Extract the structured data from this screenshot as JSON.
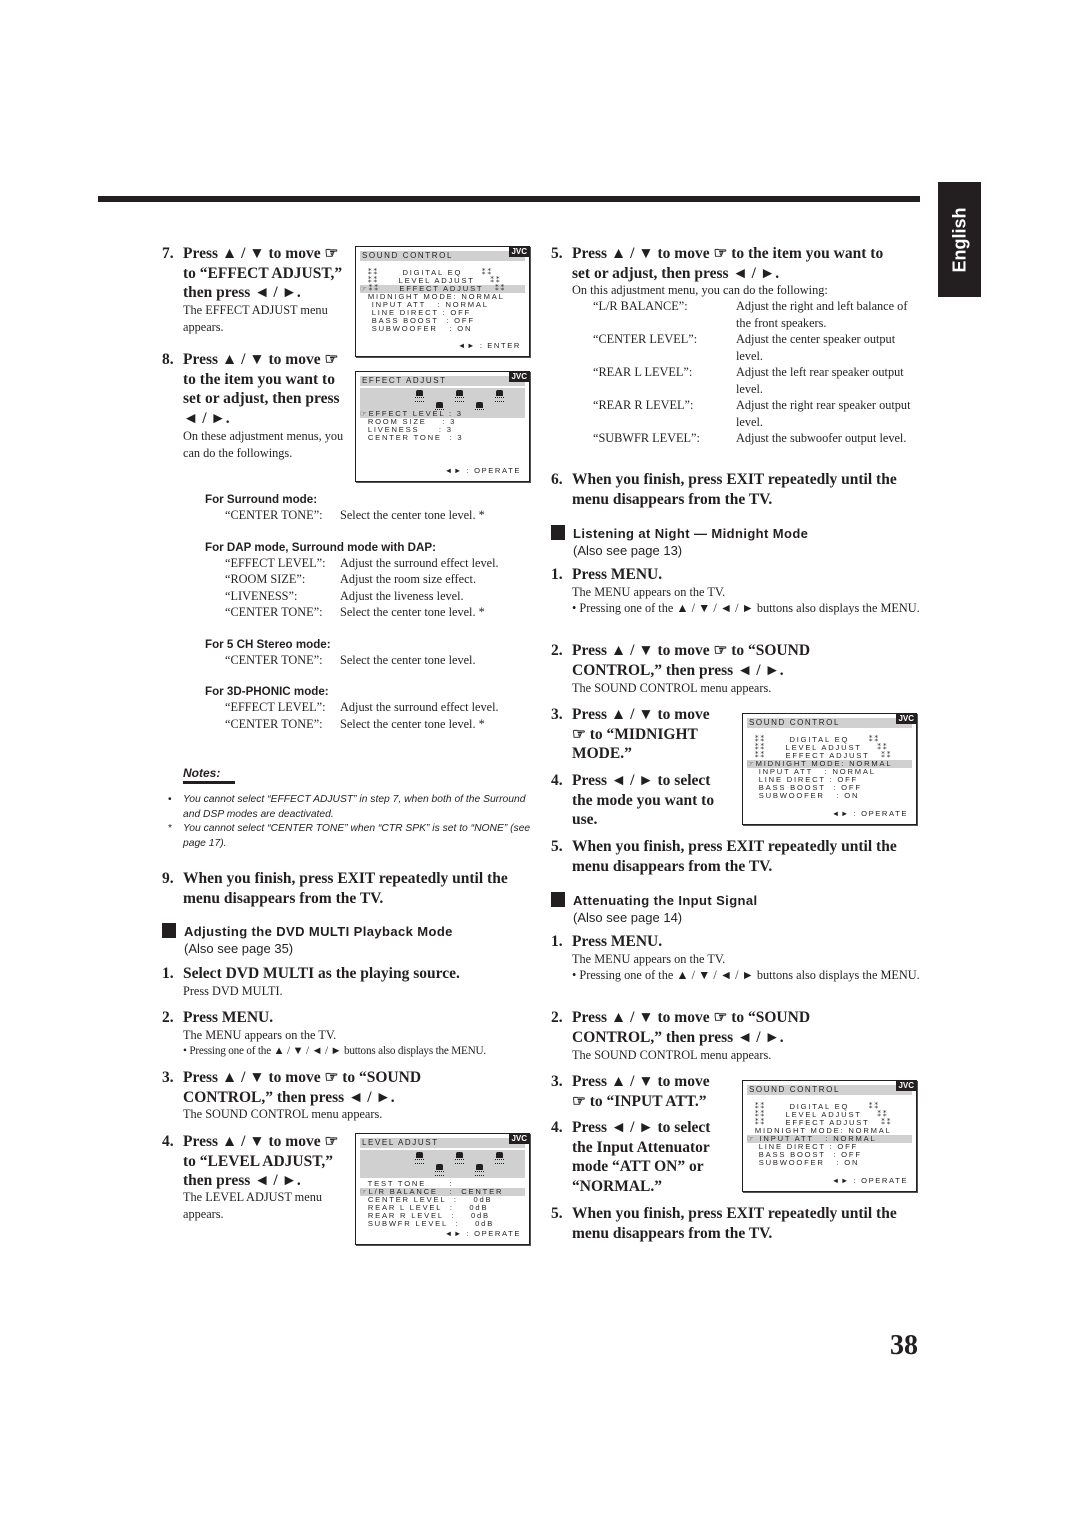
{
  "language_tab": "English",
  "page_number": "38",
  "left": {
    "step7": {
      "num": "7.",
      "line1": "Press ▲ / ▼ to move ☞",
      "line2": "to “EFFECT ADJUST,”",
      "line3": "then  press ◄ / ►.",
      "body": "The EFFECT ADJUST menu appears."
    },
    "step8": {
      "num": "8.",
      "line1": "Press ▲ / ▼ to move ☞",
      "line2": "to the item you want to",
      "line3": "set or adjust, then press",
      "line4": "◄ / ►.",
      "body": "On these adjustment menus, you can do the followings."
    },
    "modes": [
      {
        "head": "For Surround mode:",
        "rows": [
          [
            "“CENTER TONE”:",
            "Select the center tone level. *"
          ]
        ]
      },
      {
        "head": "For DAP mode, Surround mode with DAP:",
        "rows": [
          [
            "“EFFECT LEVEL”:",
            "Adjust the surround effect level."
          ],
          [
            "“ROOM SIZE”:",
            "Adjust the room size effect."
          ],
          [
            "“LIVENESS”:",
            "Adjust the liveness level."
          ],
          [
            "“CENTER TONE”:",
            "Select the center tone level. *"
          ]
        ]
      },
      {
        "head": "For 5 CH Stereo mode:",
        "rows": [
          [
            "“CENTER TONE”:",
            "Select the center tone level."
          ]
        ]
      },
      {
        "head": "For 3D-PHONIC mode:",
        "rows": [
          [
            "“EFFECT LEVEL”:",
            "Adjust the surround effect level."
          ],
          [
            "“CENTER TONE”:",
            "Select the center tone level. *"
          ]
        ]
      }
    ],
    "notes": {
      "title": "Notes:",
      "items": [
        {
          "mark": "•",
          "text": "You cannot select  “EFFECT ADJUST” in step 7, when both of the Surround and DSP modes are deactivated."
        },
        {
          "mark": "*",
          "text": "You cannot select “CENTER TONE” when “CTR SPK” is set to “NONE” (see page 17)."
        }
      ]
    },
    "step9": {
      "num": "9.",
      "text": "When you finish, press EXIT repeatedly until the menu disappears from the TV."
    },
    "dvd_section": {
      "title": "Adjusting the DVD MULTI Playback Mode",
      "subtitle": "(Also see page 35)",
      "steps": [
        {
          "num": "1.",
          "text": "Select DVD MULTI as the playing source.",
          "body": "Press DVD MULTI."
        },
        {
          "num": "2.",
          "text": "Press MENU.",
          "body": "The MENU appears on the TV.",
          "bullet": "• Pressing one of the ▲ / ▼ / ◄ / ► buttons also displays the MENU."
        },
        {
          "num": "3.",
          "line1": "Press ▲ / ▼ to move ☞ to “SOUND",
          "line2": "CONTROL,” then press ◄ / ►.",
          "body": "The SOUND CONTROL menu appears."
        },
        {
          "num": "4.",
          "line1": "Press ▲ / ▼ to move ☞",
          "line2": "to “LEVEL ADJUST,”",
          "line3": "then press ◄ / ►.",
          "body": "The LEVEL ADJUST menu appears."
        }
      ]
    }
  },
  "right": {
    "step5": {
      "num": "5.",
      "line1": "Press ▲ / ▼ to move ☞ to the item you want to",
      "line2": "set or adjust, then press ◄ / ►.",
      "body": "On this adjustment menu, you can do the following:",
      "rows": [
        [
          "“L/R BALANCE”:",
          "Adjust the right and left balance of the front speakers."
        ],
        [
          "“CENTER LEVEL”:",
          "Adjust the center speaker output level."
        ],
        [
          "“REAR L LEVEL”:",
          "Adjust the left rear speaker output level."
        ],
        [
          "“REAR R LEVEL”:",
          "Adjust the right rear speaker output level."
        ],
        [
          "“SUBWFR LEVEL”:",
          "Adjust the subwoofer output level."
        ]
      ]
    },
    "step6": {
      "num": "6.",
      "text": "When you finish, press EXIT repeatedly until the menu disappears from the TV."
    },
    "midnight": {
      "title": "Listening at Night — Midnight Mode",
      "subtitle": "(Also see page 13)",
      "s1": {
        "num": "1.",
        "text": "Press MENU.",
        "body": "The MENU appears on the TV.",
        "bullet": "• Pressing one of the ▲ / ▼ / ◄ / ► buttons also displays the MENU."
      },
      "s2": {
        "num": "2.",
        "line1": "Press ▲ / ▼ to move ☞ to “SOUND",
        "line2": "CONTROL,” then press ◄ / ►.",
        "body": "The SOUND CONTROL menu appears."
      },
      "s3": {
        "num": "3.",
        "line1": "Press ▲ / ▼ to move",
        "line2": "☞ to “MIDNIGHT",
        "line3": "MODE.”"
      },
      "s4": {
        "num": "4.",
        "line1": "Press ◄ / ► to select",
        "line2": "the mode you want to",
        "line3": "use."
      },
      "s5": {
        "num": "5.",
        "text": "When you finish, press EXIT repeatedly until the menu disappears from the TV."
      }
    },
    "attenuate": {
      "title": "Attenuating the Input Signal",
      "subtitle": "(Also see page 14)",
      "s1": {
        "num": "1.",
        "text": "Press MENU.",
        "body": "The MENU appears on the TV.",
        "bullet": "• Pressing one of the ▲ / ▼ / ◄ / ► buttons also displays the MENU."
      },
      "s2": {
        "num": "2.",
        "line1": "Press ▲ / ▼ to move ☞ to “SOUND",
        "line2": "CONTROL,” then press ◄ / ►.",
        "body": "The SOUND CONTROL menu appears."
      },
      "s3": {
        "num": "3.",
        "line1": "Press ▲ / ▼ to move",
        "line2": "☞ to “INPUT ATT.”"
      },
      "s4": {
        "num": "4.",
        "line1": "Press ◄ / ► to select",
        "line2": "the Input Attenuator",
        "line3": "mode “ATT ON” or",
        "line4": "“NORMAL.”"
      },
      "s5": {
        "num": "5.",
        "text": "When you finish, press EXIT repeatedly until the menu disappears from the TV."
      }
    }
  },
  "screens": {
    "sc1": {
      "title": "SOUND CONTROL",
      "brand": "JVC",
      "lines": [
        "  ⁑⁑      DIGITAL EQ     ⁑⁑",
        "  ⁑⁑     LEVEL ADJUST    ⁑⁑",
        "☞⁑⁑     EFFECT ADJUST   ⁑⁑",
        "  MIDNIGHT MODE: NORMAL",
        "   INPUT ATT   : NORMAL",
        "   LINE DIRECT : OFF",
        "   BASS BOOST  : OFF",
        "   SUBWOOFER   : ON"
      ],
      "highlight": 2,
      "footer": "◄► : ENTER"
    },
    "sc2": {
      "title": "EFFECT ADJUST",
      "brand": "JVC",
      "lines": [
        "☞EFFECT LEVEL : 3",
        "  ROOM SIZE    : 3",
        "  LIVENESS     : 3",
        "  CENTER TONE  : 3"
      ],
      "highlight": 0,
      "footer": "◄► : OPERATE"
    },
    "sc3": {
      "title": "LEVEL ADJUST",
      "brand": "JVC",
      "lines": [
        "  TEST TONE      :",
        "☞L/R BALANCE   :  CENTER",
        "  CENTER LEVEL  :    0dB",
        "  REAR L LEVEL  :    0dB",
        "  REAR R LEVEL  :    0dB",
        "  SUBWFR LEVEL  :    0dB"
      ],
      "highlight": 1,
      "footer": "◄► : OPERATE"
    },
    "sc4": {
      "title": "SOUND CONTROL",
      "brand": "JVC",
      "lines": [
        "  ⁑⁑      DIGITAL EQ     ⁑⁑",
        "  ⁑⁑     LEVEL ADJUST    ⁑⁑",
        "  ⁑⁑     EFFECT ADJUST   ⁑⁑",
        "☞MIDNIGHT MODE: NORMAL",
        "   INPUT ATT   : NORMAL",
        "   LINE DIRECT : OFF",
        "   BASS BOOST  : OFF",
        "   SUBWOOFER   : ON"
      ],
      "highlight": 3,
      "footer": "◄► : OPERATE"
    },
    "sc5": {
      "title": "SOUND CONTROL",
      "brand": "JVC",
      "lines": [
        "  ⁑⁑      DIGITAL EQ     ⁑⁑",
        "  ⁑⁑     LEVEL ADJUST    ⁑⁑",
        "  ⁑⁑     EFFECT ADJUST   ⁑⁑",
        "  MIDNIGHT MODE: NORMAL",
        "☞ INPUT ATT   : NORMAL",
        "   LINE DIRECT : OFF",
        "   BASS BOOST  : OFF",
        "   SUBWOOFER   : ON"
      ],
      "highlight": 4,
      "footer": "◄► : OPERATE"
    }
  }
}
